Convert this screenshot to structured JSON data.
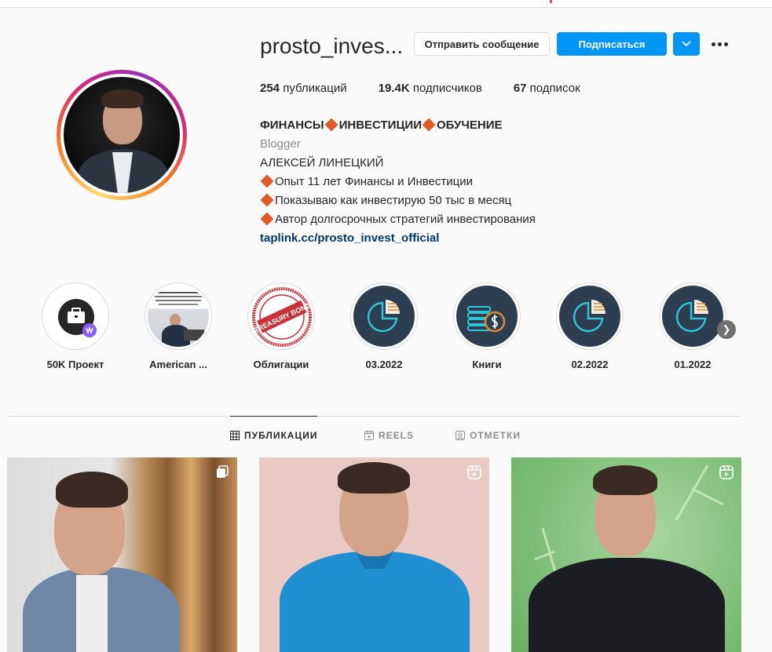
{
  "profile": {
    "username": "prosto_inves...",
    "buttons": {
      "message": "Отправить сообщение",
      "subscribe": "Подписаться"
    },
    "stats": [
      {
        "count": "254",
        "label": "публикаций"
      },
      {
        "count": "19.4K",
        "label": "подписчиков"
      },
      {
        "count": "67",
        "label": "подписок"
      }
    ],
    "bio": {
      "name_parts": [
        "ФИНАНСЫ",
        "ИНВЕСТИЦИИ",
        "ОБУЧЕНИЕ"
      ],
      "category": "Blogger",
      "lines": [
        "АЛЕКСЕЙ ЛИНЕЦКИЙ",
        "Опыт 11 лет Финансы и Инвестиции",
        "Показываю как инвестирую 50 тыс в месяц",
        "Автор долгосрочных стратегий инвестирования"
      ],
      "link": "taplink.cc/prosto_invest_official"
    }
  },
  "highlights": [
    {
      "label": "50K Проект",
      "icon": "briefcase-icon"
    },
    {
      "label": "American ...",
      "icon": "photo-thumbnail"
    },
    {
      "label": "Облигации",
      "icon": "treasury-bond-stamp",
      "stamp_text": "TREASURY BOND"
    },
    {
      "label": "03.2022",
      "icon": "pie-chart-icon"
    },
    {
      "label": "Книги",
      "icon": "coins-dollar-icon"
    },
    {
      "label": "02.2022",
      "icon": "pie-chart-icon"
    },
    {
      "label": "01.2022",
      "icon": "pie-chart-icon"
    }
  ],
  "tabs": [
    {
      "label": "ПУБЛИКАЦИИ",
      "icon": "grid-icon",
      "active": true
    },
    {
      "label": "REELS",
      "icon": "reels-icon",
      "active": false
    },
    {
      "label": "ОТМЕТКИ",
      "icon": "tagged-icon",
      "active": false
    }
  ],
  "colors": {
    "accent": "#0095f6",
    "link": "#00376b",
    "diamond": "#e05a2b",
    "highlight_bg": "#2c3e50"
  }
}
